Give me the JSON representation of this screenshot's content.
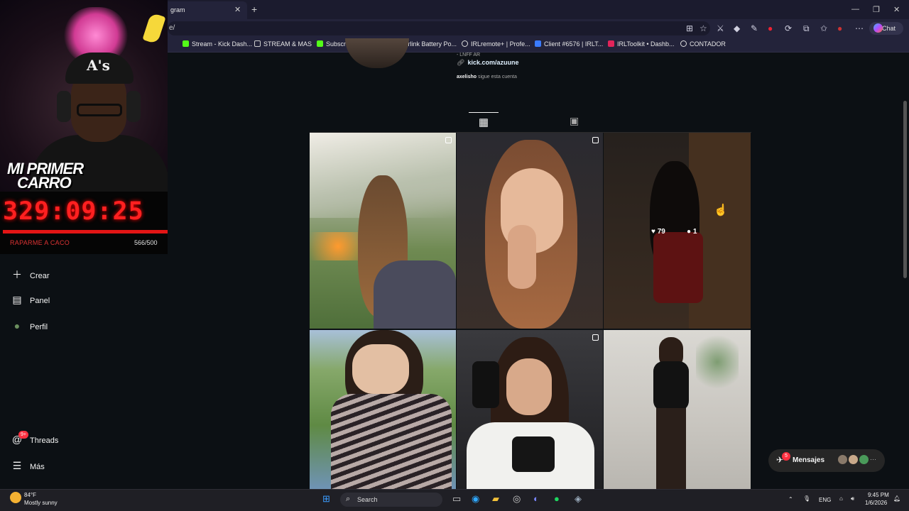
{
  "browser": {
    "tab_title": "gram",
    "address": "e/",
    "chat_label": "Chat",
    "bookmarks": [
      {
        "label": "Stream - Kick Dash...",
        "color": "#53fc18"
      },
      {
        "label": "STREAM & MAS",
        "color": "#cccccc"
      },
      {
        "label": "Subscribe to MrVar...",
        "color": "#53fc18"
      },
      {
        "label": "Starlink Battery Po...",
        "color": "#ffffff"
      },
      {
        "label": "IRLremote+ | Profe...",
        "color": "#dddddd"
      },
      {
        "label": "Client #6576 | IRLT...",
        "color": "#3a7bff"
      },
      {
        "label": "IRLToolkit • Dashb...",
        "color": "#e2245a"
      },
      {
        "label": "CONTADOR",
        "color": "#dddddd"
      }
    ]
  },
  "overlay": {
    "promo_line1": "MI PRIMER",
    "promo_line2": "CARRO",
    "timer": "329:09:25",
    "goal_label": "RAPARME A CACO",
    "goal_count": "566/500",
    "goal_progress": 1.0
  },
  "sidebar": {
    "items": [
      {
        "label": "Crear",
        "icon": "plus-icon"
      },
      {
        "label": "Panel",
        "icon": "dashboard-icon"
      },
      {
        "label": "Perfil",
        "icon": "profile-avatar-icon"
      },
      {
        "label": "Threads",
        "icon": "threads-icon",
        "badge": "9+"
      },
      {
        "label": "Más",
        "icon": "menu-icon"
      }
    ]
  },
  "profile": {
    "bio_fragment": "- LNFF AR",
    "link": "kick.com/azuune",
    "followed_by_user": "axelisho",
    "followed_by_text": " sigue esta cuenta"
  },
  "posts": [
    {
      "multi": true
    },
    {
      "multi": true
    },
    {
      "multi": false,
      "likes": "79",
      "comments": "1",
      "hovered": true
    },
    {
      "multi": false
    },
    {
      "multi": true
    },
    {
      "multi": false
    }
  ],
  "messages": {
    "label": "Mensajes",
    "badge": "5"
  },
  "taskbar": {
    "temperature": "84°F",
    "weather": "Mostly sunny",
    "search_label": "Search",
    "language": "ENG",
    "time": "9:45 PM",
    "date": "1/6/2026"
  }
}
